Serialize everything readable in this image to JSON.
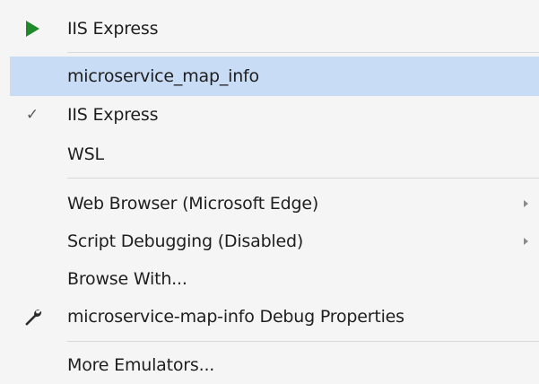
{
  "menu": {
    "run_label": "IIS Express",
    "profile_label": "microservice_map_info",
    "iis_label": "IIS Express",
    "iis_check": "✓",
    "wsl_label": "WSL",
    "browser_label": "Web Browser (Microsoft Edge)",
    "script_debug_label": "Script Debugging (Disabled)",
    "browse_with_label": "Browse With...",
    "debug_props_label": "microservice-map-info Debug Properties",
    "emulators_label": "More Emulators..."
  },
  "colors": {
    "menu_background": "#f5f5f5",
    "highlight": "#c9dcf5",
    "run_green": "#1e8a2c",
    "separator": "#d9d9d9"
  },
  "icons": {
    "run": "play-icon",
    "check": "checkmark-icon",
    "properties": "wrench-icon",
    "submenu": "chevron-right-icon"
  }
}
